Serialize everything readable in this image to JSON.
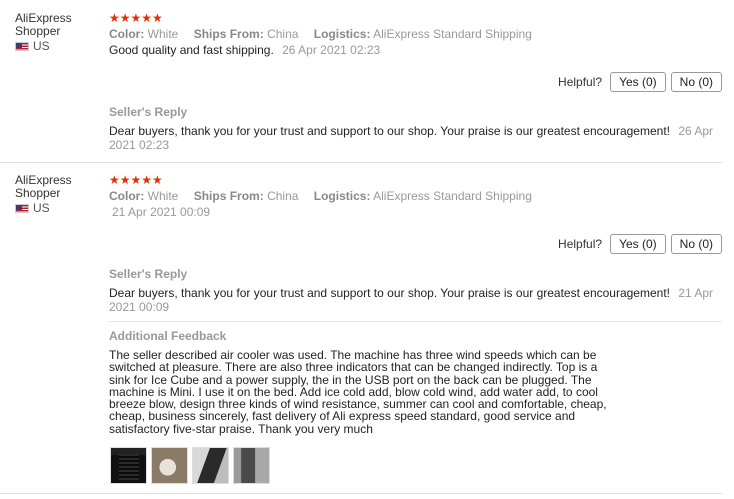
{
  "reviews": [
    {
      "user_name": "AliExpress Shopper",
      "country": "US",
      "stars": "★★★★★",
      "color_label": "Color:",
      "color_value": "White",
      "ships_label": "Ships From:",
      "ships_value": "China",
      "logistics_label": "Logistics:",
      "logistics_value": "AliExpress Standard Shipping",
      "text": "Good quality and fast shipping.",
      "date": "26 Apr 2021 02:23",
      "helpful_label": "Helpful?",
      "yes_label": "Yes (0)",
      "no_label": "No (0)",
      "reply_title": "Seller's Reply",
      "reply_text": "Dear buyers, thank you for your trust and support to our shop. Your praise is our greatest encouragement!",
      "reply_date": "26 Apr 2021 02:23"
    },
    {
      "user_name": "AliExpress Shopper",
      "country": "US",
      "stars": "★★★★★",
      "color_label": "Color:",
      "color_value": "White",
      "ships_label": "Ships From:",
      "ships_value": "China",
      "logistics_label": "Logistics:",
      "logistics_value": "AliExpress Standard Shipping",
      "date": "21 Apr 2021 00:09",
      "helpful_label": "Helpful?",
      "yes_label": "Yes (0)",
      "no_label": "No (0)",
      "reply_title": "Seller's Reply",
      "reply_text": "Dear buyers, thank you for your trust and support to our shop. Your praise is our greatest encouragement!",
      "reply_date": "21 Apr 2021 00:09",
      "additional_title": "Additional Feedback",
      "additional_text": "The seller described air cooler was used. The machine has three wind speeds which can be switched at pleasure. There are also three indicators that can be changed indirectly. Top is a sink for Ice Cube and a power supply, the in the USB port on the back can be plugged. The machine is Mini. I use it on the bed. Add ice cold add, blow cold wind, add water add, to cool breeze blow, design three kinds of wind resistance, summer can cool and comfortable, cheap, cheap, business sincerely, fast delivery of Ali express speed standard, good service and satisfactory five-star praise. Thank you very much"
    }
  ],
  "colors": {
    "star": "#e62e04",
    "muted": "#999999",
    "text": "#222222"
  }
}
